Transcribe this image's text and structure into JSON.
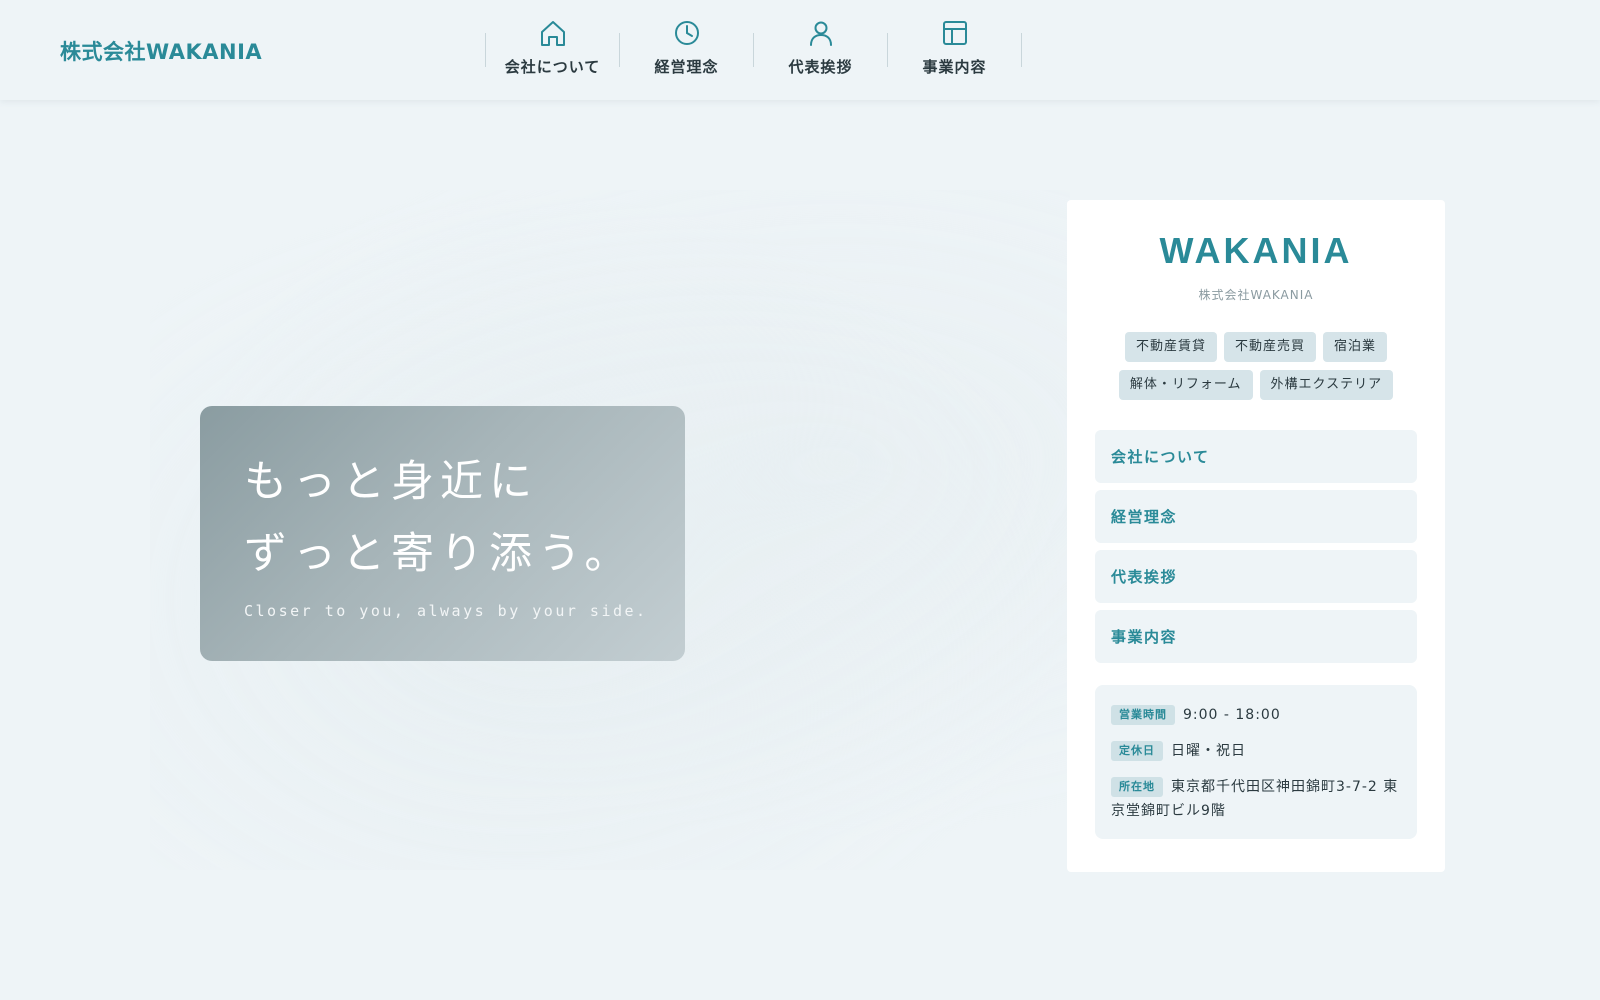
{
  "header": {
    "brand": "株式会社WAKANIA",
    "nav": [
      {
        "label": "会社について",
        "icon": "home-icon"
      },
      {
        "label": "経営理念",
        "icon": "clock-icon"
      },
      {
        "label": "代表挨拶",
        "icon": "user-icon"
      },
      {
        "label": "事業内容",
        "icon": "layout-icon"
      }
    ]
  },
  "hero": {
    "title_line1": "もっと身近に",
    "title_line2": "ずっと寄り添う。",
    "subtitle": "Closer to you, always by your side."
  },
  "panel": {
    "logo": "WAKANIA",
    "company": "株式会社WAKANIA",
    "tags": [
      "不動産賃貸",
      "不動産売買",
      "宿泊業",
      "解体・リフォーム",
      "外構エクステリア"
    ],
    "menu": [
      "会社について",
      "経営理念",
      "代表挨拶",
      "事業内容"
    ],
    "info": {
      "hours_label": "営業時間",
      "hours_value": "9:00 - 18:00",
      "closed_label": "定休日",
      "closed_value": "日曜・祝日",
      "address_label": "所在地",
      "address_value": "東京都千代田区神田錦町3-7-2 東京堂錦町ビル9階"
    }
  },
  "colors": {
    "accent": "#2a8a98",
    "background": "#eef4f7",
    "tag_bg": "#d6e4e9"
  }
}
